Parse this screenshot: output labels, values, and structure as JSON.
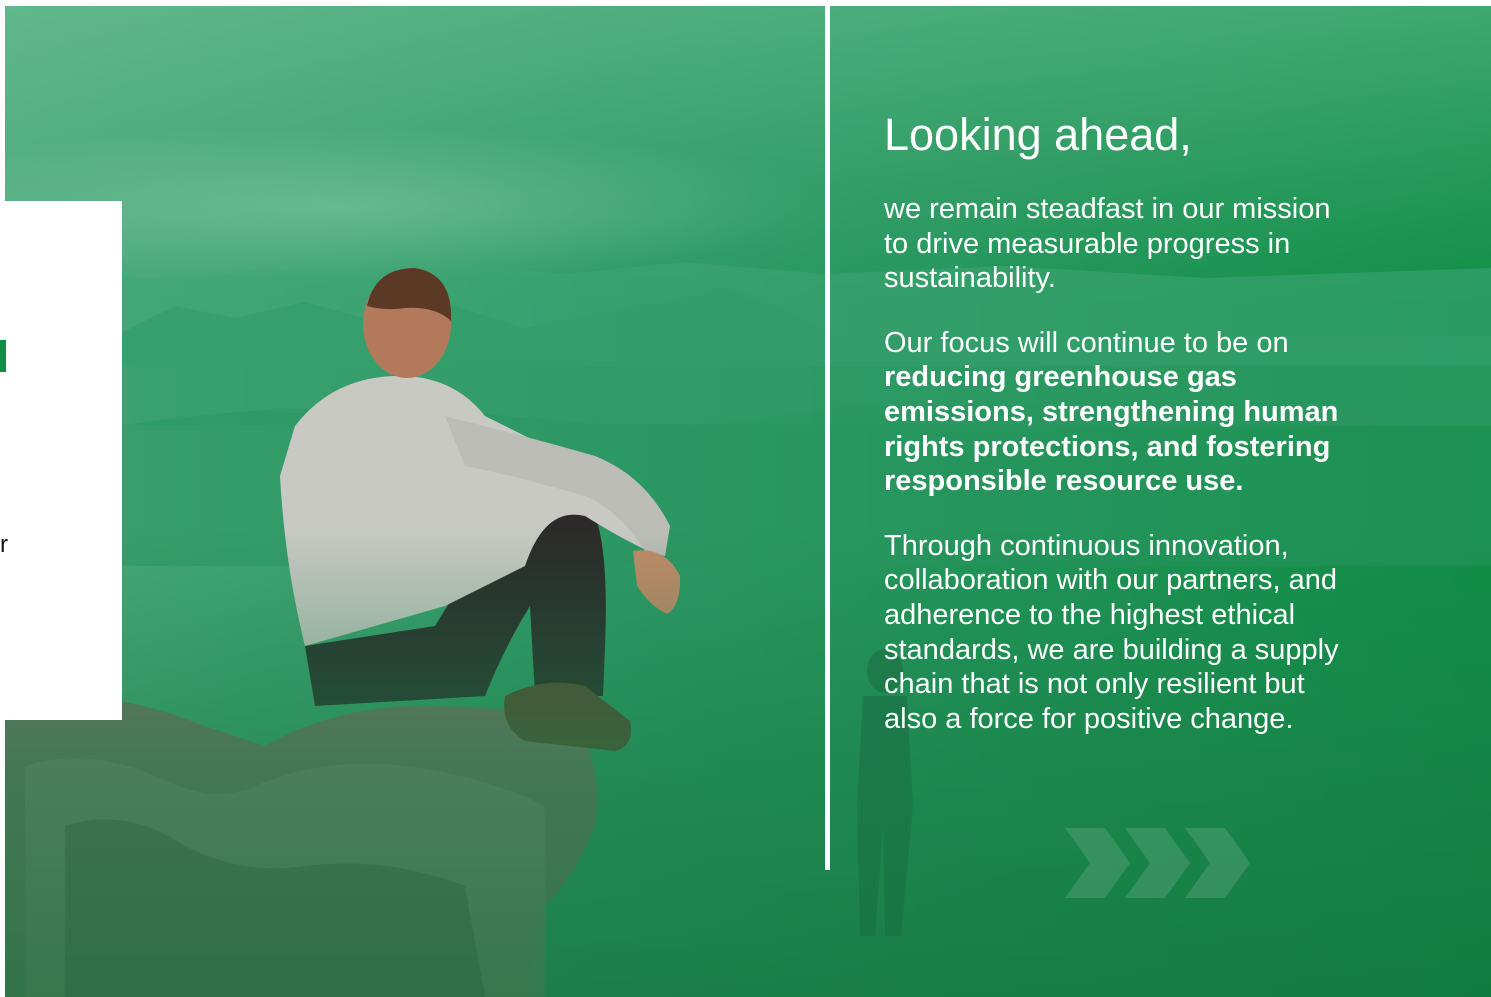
{
  "panel": {
    "fragment": "r"
  },
  "content": {
    "heading": "Looking ahead,",
    "paragraph1": "we remain steadfast in our mission to drive measurable progress in sustainability.",
    "paragraph2_intro": "Our focus will continue to be on ",
    "paragraph2_bold": "reducing greenhouse gas emissions, strengthening human rights protections, and fostering responsible resource use.",
    "paragraph3": "Through continuous innovation, collaboration with our partners, and adherence to the highest ethical standards, we are building a supply chain that is not only resilient but also a force for positive change."
  },
  "decor": {
    "accent_color": "#0f8e45",
    "icons": [
      "chevron-arrows-icon"
    ]
  }
}
